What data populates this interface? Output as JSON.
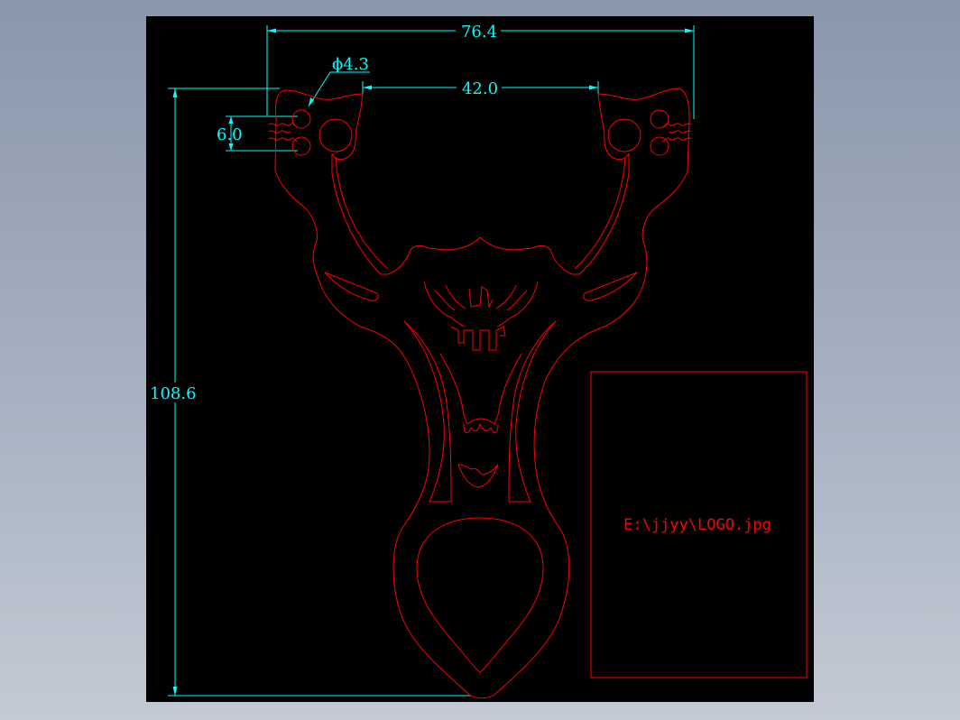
{
  "drawing": {
    "sheet_color": "#000000",
    "geometry_color": "#ff0000",
    "dimension_color": "#00ffff",
    "dimensions": {
      "overall_width": "76.4",
      "inner_gap": "42.0",
      "hole_diameter": "ϕ4.3",
      "slot_height": "6.0",
      "overall_height": "108.6"
    },
    "image_reference": "E:\\jjyy\\LOGO.jpg"
  }
}
